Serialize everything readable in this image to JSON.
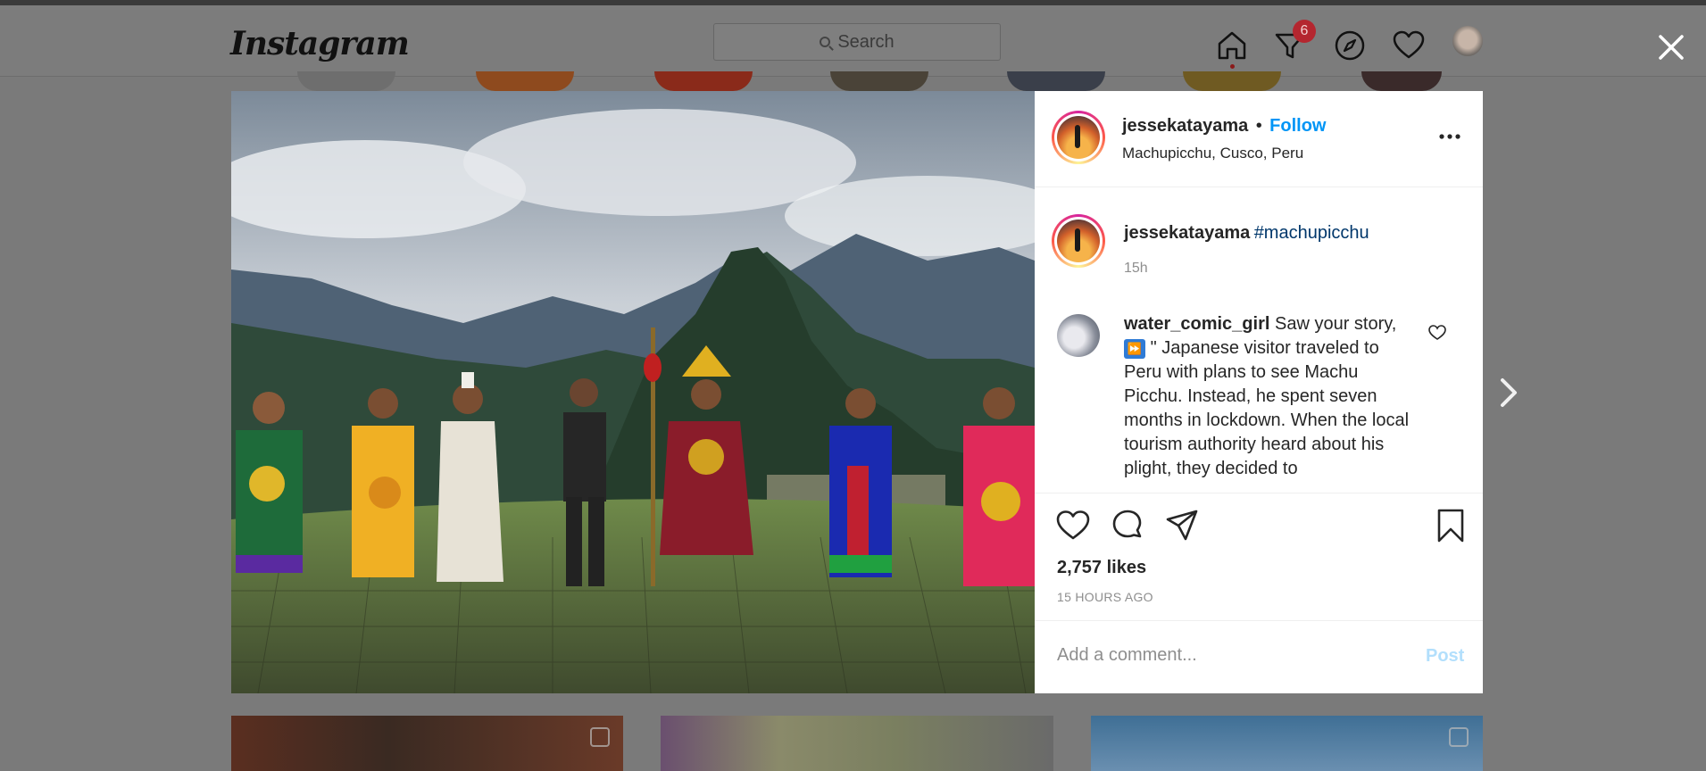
{
  "header": {
    "logo": "Instagram",
    "search_placeholder": "Search",
    "notification_count": "6"
  },
  "post": {
    "username": "jessekatayama",
    "separator": "•",
    "follow_label": "Follow",
    "location": "Machupicchu, Cusco, Peru",
    "caption_username": "jessekatayama",
    "caption_hashtag": "#machupicchu",
    "caption_time": "15h",
    "likes": "2,757 likes",
    "posted_ago": "15 HOURS AGO"
  },
  "comments": [
    {
      "username": "water_comic_girl",
      "emoji": "⏩",
      "text_before": "Saw your story,",
      "text_after": "\" Japanese visitor traveled to Peru with plans to see Machu Picchu. Instead, he spent seven months in lockdown. When the local tourism authority heard about his plight, they decided to"
    }
  ],
  "comment_box": {
    "placeholder": "Add a comment...",
    "post_label": "Post"
  },
  "colors": {
    "follow": "#0095f6",
    "hashtag": "#00376b",
    "post_disabled": "#b2dffc",
    "overlay": "#7a7a7a"
  },
  "icons": [
    "home-icon",
    "direct-icon",
    "explore-icon",
    "activity-heart-icon",
    "close-icon",
    "next-arrow-icon",
    "like-icon",
    "comment-icon",
    "share-icon",
    "save-icon",
    "more-options-icon"
  ]
}
